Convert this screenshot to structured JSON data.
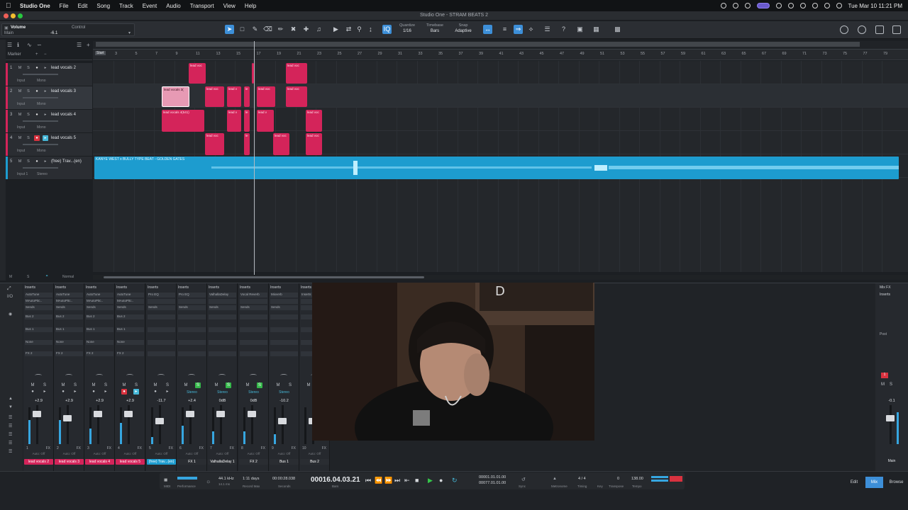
{
  "menubar": {
    "app": "Studio One",
    "items": [
      "File",
      "Edit",
      "Song",
      "Track",
      "Event",
      "Audio",
      "Transport",
      "View",
      "Help"
    ],
    "clock": "Tue Mar 10  11:21 PM"
  },
  "window": {
    "title": "Studio One - STRAM BEATS 2"
  },
  "toolbar": {
    "param_name": "Volume",
    "param_target": "Main",
    "param_value": "-6.1",
    "control_label": "Control",
    "quantize_label": "Quantize",
    "quantize_value": "1/16",
    "timebase_label": "Timebase",
    "timebase_value": "Bars",
    "snap_label": "Snap",
    "snap_value": "Adaptive"
  },
  "arrange": {
    "marker_label": "Marker",
    "start_label": "Start",
    "bar_numbers": [
      "3",
      "5",
      "7",
      "9",
      "11",
      "13",
      "15",
      "17",
      "19",
      "21",
      "23",
      "25",
      "27",
      "29",
      "31",
      "33",
      "35",
      "37",
      "39",
      "41",
      "43",
      "45",
      "47",
      "49",
      "51",
      "53",
      "55",
      "57",
      "59",
      "61",
      "63",
      "65",
      "67",
      "69",
      "71",
      "73",
      "75",
      "77",
      "79"
    ],
    "bottom_mode": "Normal",
    "tracks": [
      {
        "num": "1",
        "name": "lead vocals 2",
        "input": "Input",
        "mode": "Mono",
        "color": "#d4245a"
      },
      {
        "num": "2",
        "name": "lead vocals 3",
        "input": "Input",
        "mode": "Mono",
        "color": "#d4245a"
      },
      {
        "num": "3",
        "name": "lead vocals 4",
        "input": "Input",
        "mode": "Mono",
        "color": "#d4245a"
      },
      {
        "num": "4",
        "name": "lead vocals 5",
        "input": "Input",
        "mode": "Mono",
        "color": "#d4245a"
      },
      {
        "num": "5",
        "name": "(free) Trav...(en)",
        "input": "Input 1",
        "mode": "Stereo",
        "color": "#1d9ccf"
      }
    ],
    "clip_labels": {
      "lv": "lead voc",
      "lv_short": "lead v",
      "lv_le": "le",
      "lv_sel": "lead vocals 3(",
      "lv4": "lead vocals 4(541)",
      "beat": "KANYE WEST x BULLY TYPE BEAT - GOLDEN GATES"
    }
  },
  "mixer": {
    "channels": [
      {
        "insert1": "AutoTune",
        "insert2": "MAutoPitc..",
        "sends": "Sends",
        "bus": "Bus 2",
        "bus1": "Bus 1",
        "none": "None",
        "fx": "FX 2",
        "vol": "+2.9",
        "num": "1",
        "name": "lead vocals 2",
        "color": "#d4245a",
        "rec": false,
        "mon": false
      },
      {
        "insert1": "AutoTune",
        "insert2": "MAutoPitc..",
        "sends": "Sends",
        "bus": "Bus 2",
        "bus1": "Bus 1",
        "none": "None",
        "fx": "FX 2",
        "vol": "+2.9",
        "num": "2",
        "name": "lead vocals 3",
        "color": "#d4245a",
        "rec": false,
        "mon": false
      },
      {
        "insert1": "AutoTune",
        "insert2": "MAutoPitc..",
        "sends": "Sends",
        "bus": "Bus 2",
        "bus1": "Bus 1",
        "none": "None",
        "fx": "FX 2",
        "vol": "+2.9",
        "num": "3",
        "name": "lead vocals 4",
        "color": "#d4245a",
        "rec": false,
        "mon": false
      },
      {
        "insert1": "AutoTune",
        "insert2": "MAutoPitc..",
        "sends": "Sends",
        "bus": "Bus 2",
        "bus1": "Bus 1",
        "none": "None",
        "fx": "FX 2",
        "vol": "+2.9",
        "num": "4",
        "name": "lead vocals 5",
        "color": "#d4245a",
        "rec": true,
        "mon": true
      },
      {
        "insert1": "Pro EQ",
        "insert2": "",
        "sends": "Sends",
        "bus": "",
        "bus1": "",
        "none": "",
        "fx": "",
        "vol": "-11.7",
        "num": "5",
        "name": "(free) Trav...(en)",
        "color": "#1d9ccf",
        "rec": false,
        "mon": false
      },
      {
        "insert1": "Pro EQ",
        "insert2": "",
        "sends": "Sends",
        "bus": "",
        "bus1": "",
        "none": "",
        "fx": "",
        "vol": "+2.4",
        "num": "6",
        "name": "FX 1",
        "color": "#2a2d32",
        "stereo": "Stereo",
        "solo": true
      },
      {
        "insert1": "ValhallaDelay",
        "insert2": "",
        "sends": "Sends",
        "bus": "",
        "bus1": "",
        "none": "",
        "fx": "",
        "vol": "0dB",
        "num": "7",
        "name": "ValhallaDelay 1",
        "color": "#2a2d32",
        "stereo": "Stereo",
        "solo": true
      },
      {
        "insert1": "Vocal Reverb",
        "insert2": "",
        "sends": "Sends",
        "bus": "",
        "bus1": "",
        "none": "",
        "fx": "",
        "vol": "0dB",
        "num": "8",
        "name": "FX 2",
        "color": "#2a2d32",
        "stereo": "Stereo",
        "solo": true
      },
      {
        "insert1": "Mixverb",
        "insert2": "",
        "sends": "Sends",
        "bus": "",
        "bus1": "",
        "none": "",
        "fx": "",
        "vol": "-10.2",
        "num": "9",
        "name": "Bus 1",
        "color": "#2a2d32",
        "stereo": "Stereo",
        "solo": false
      },
      {
        "insert1": "Inserts",
        "insert2": "",
        "sends": "",
        "bus": "",
        "bus1": "",
        "none": "",
        "fx": "",
        "vol": "",
        "num": "10",
        "name": "Bus 2",
        "color": "#2a2d32",
        "stereo": "",
        "solo": false
      }
    ],
    "inserts_label": "Inserts",
    "mixfx_label": "Mix FX",
    "auto_label": "Auto: Off",
    "fx_label": "FX",
    "main": {
      "vol": "-0.1",
      "name": "Main",
      "inserts": "Inserts",
      "post": "Post",
      "mixfx": "Mix FX"
    }
  },
  "transport": {
    "midi": "MIDI",
    "performance": "Performance",
    "sample_rate": "44.1 kHz",
    "latency": "14.1 ms",
    "record_max": "1:11 days",
    "record_max_label": "Record Max",
    "seconds": "00:00:28.038",
    "seconds_label": "Seconds",
    "position": "00016.04.03.21",
    "position_label": "Bars",
    "loop_start": "00001.01.01.00",
    "loop_end": "00077.01.01.00",
    "sync_label": "Sync",
    "metronome_label": "Metronome",
    "timing_value": "4 / 4",
    "timing_label": "Timing",
    "key_label": "Key",
    "transpose_value": "0",
    "transpose_label": "Transpose",
    "tempo_value": "138.00",
    "tempo_label": "Tempo"
  },
  "views": {
    "edit": "Edit",
    "mix": "Mix",
    "browse": "Browse"
  }
}
